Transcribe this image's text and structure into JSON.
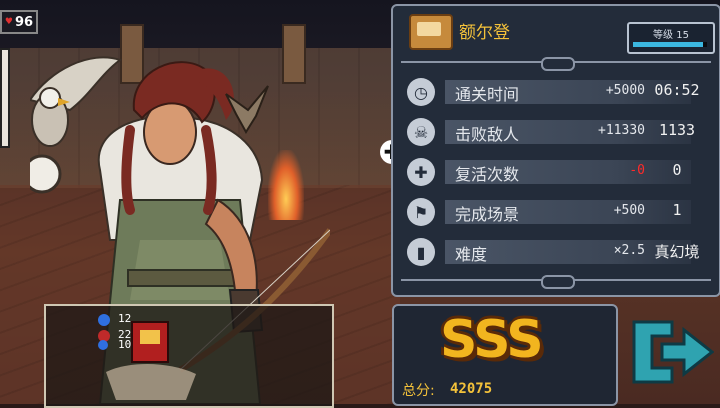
{
  "hud": {
    "hp_value": "96"
  },
  "hero": {
    "name": "额尔登",
    "level_label": "等级 15",
    "xp_progress": 0.95
  },
  "stats": [
    {
      "icon": "clock-icon",
      "label": "通关时间",
      "bonus": "+5000",
      "bonus_color": "#e4e7ec",
      "value": "06:52"
    },
    {
      "icon": "skull-icon",
      "label": "击败敌人",
      "bonus": "+11330",
      "bonus_color": "#e4e7ec",
      "value": "1133"
    },
    {
      "icon": "revive-icon",
      "label": "复活次数",
      "bonus": "-0",
      "bonus_color": "#ff2a2a",
      "value": "0"
    },
    {
      "icon": "flag-icon",
      "label": "完成场景",
      "bonus": "+500",
      "bonus_color": "#e4e7ec",
      "value": "1"
    },
    {
      "icon": "difficulty-icon",
      "label": "难度",
      "bonus": "×2.5",
      "bonus_color": "#e4e7ec",
      "value": "真幻境"
    }
  ],
  "result": {
    "grade": "SSS",
    "total_label": "总分:",
    "total_value": "42075"
  },
  "minimap": {
    "counter_a": "12",
    "counter_b": "22",
    "counter_c": "10"
  },
  "colors": {
    "gold": "#f2b51f",
    "panel_bg": "#232c3a",
    "accent_blue": "#3bb7e0",
    "exit_teal": "#2fa3b0"
  }
}
